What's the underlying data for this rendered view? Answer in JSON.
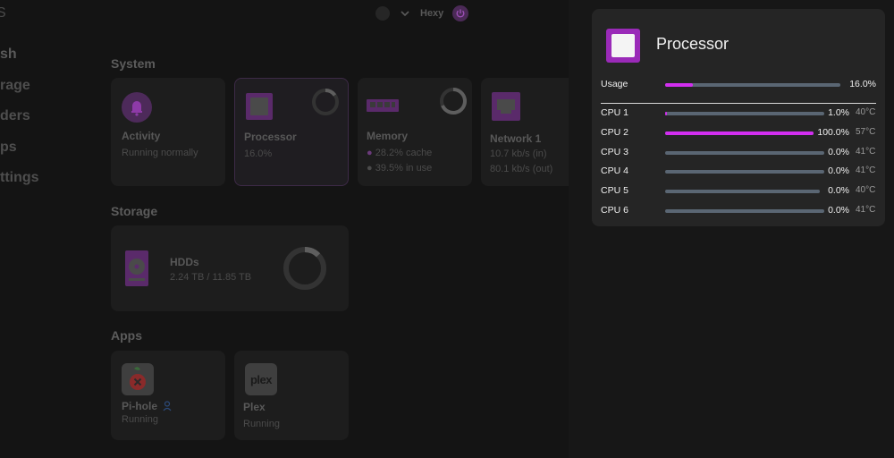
{
  "sidebar": {
    "logo_fragment": "S",
    "items": [
      {
        "label": "sh"
      },
      {
        "label": "rage"
      },
      {
        "label": "ders"
      },
      {
        "label": "ps"
      },
      {
        "label": "ttings"
      }
    ]
  },
  "topbar": {
    "user": "Hexy"
  },
  "sections": {
    "system": "System",
    "storage": "Storage",
    "apps": "Apps"
  },
  "cards": {
    "activity": {
      "title": "Activity",
      "status": "Running normally"
    },
    "processor": {
      "title": "Processor",
      "value": "16.0%"
    },
    "memory": {
      "title": "Memory",
      "cache": "28.2% cache",
      "in_use": "39.5% in use"
    },
    "network": {
      "title": "Network 1",
      "in": "10.7 kb/s (in)",
      "out": "80.1 kb/s (out)"
    },
    "hdds": {
      "title": "HDDs",
      "usage": "2.24 TB / 11.85 TB"
    },
    "pihole": {
      "title": "Pi-hole",
      "status": "Running"
    },
    "plex": {
      "title": "Plex",
      "status": "Running",
      "logo_text": "plex"
    }
  },
  "panel": {
    "title": "Processor",
    "usage": {
      "label": "Usage",
      "value": "16.0%",
      "fraction": 0.16
    },
    "cpus": [
      {
        "label": "CPU 1",
        "value": "1.0%",
        "temp": "40°C",
        "fraction": 0.01
      },
      {
        "label": "CPU 2",
        "value": "100.0%",
        "temp": "57°C",
        "fraction": 1.0
      },
      {
        "label": "CPU 3",
        "value": "0.0%",
        "temp": "41°C",
        "fraction": 0.0
      },
      {
        "label": "CPU 4",
        "value": "0.0%",
        "temp": "41°C",
        "fraction": 0.0
      },
      {
        "label": "CPU 5",
        "value": "0.0%",
        "temp": "40°C",
        "fraction": 0.0
      },
      {
        "label": "CPU 6",
        "value": "0.0%",
        "temp": "41°C",
        "fraction": 0.0
      }
    ]
  },
  "colors": {
    "accent": "#d22ef0",
    "icon_purple": "#9a2ab8",
    "track": "#5a6673"
  }
}
